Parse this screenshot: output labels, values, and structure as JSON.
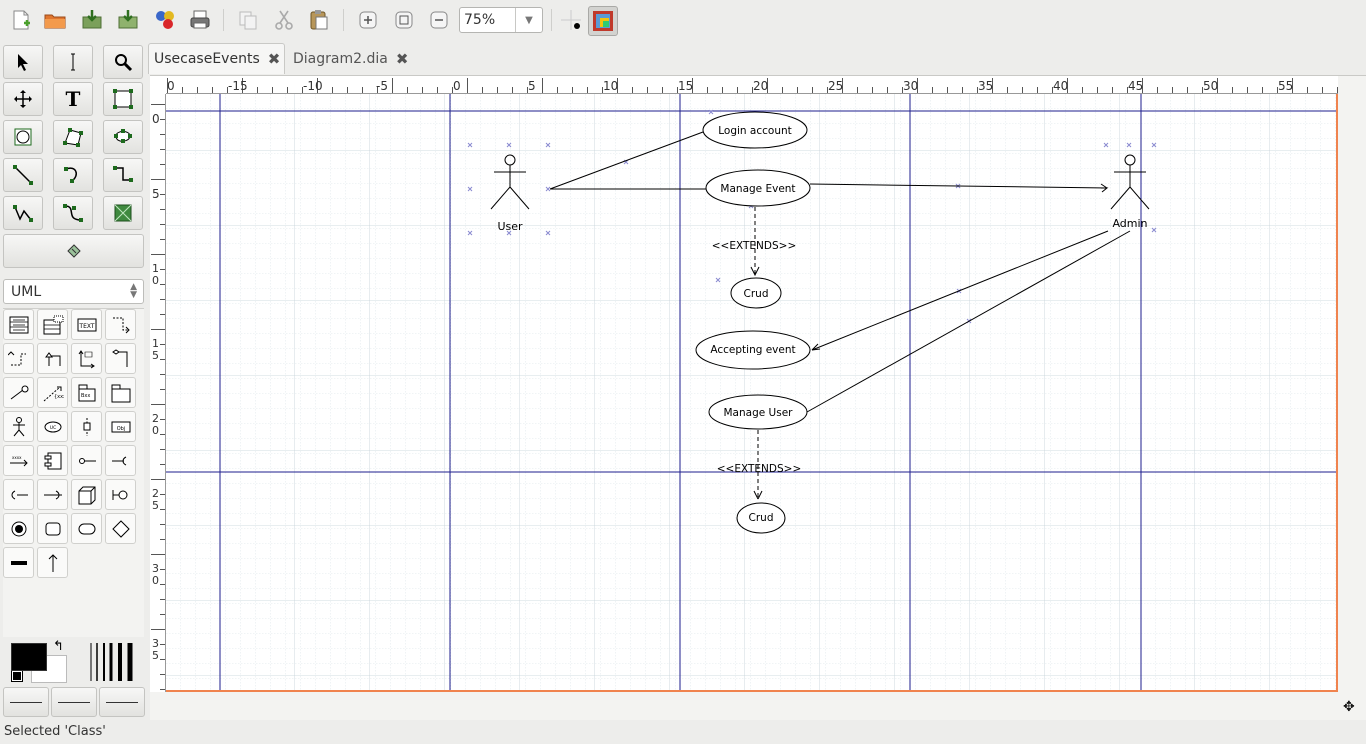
{
  "toolbar": {
    "buttons": [
      {
        "name": "new-diagram-icon"
      },
      {
        "name": "open-icon"
      },
      {
        "name": "save-icon"
      },
      {
        "name": "save-as-icon"
      },
      {
        "name": "export-icon"
      },
      {
        "name": "print-icon"
      },
      {
        "name": "copy-icon"
      },
      {
        "name": "cut-icon"
      },
      {
        "name": "paste-icon"
      },
      {
        "name": "zoom-in-icon"
      },
      {
        "name": "zoom-fit-icon"
      },
      {
        "name": "zoom-out-icon"
      },
      {
        "name": "snap-to-grid-icon"
      },
      {
        "name": "snap-to-objects-icon"
      }
    ],
    "zoom": "75%"
  },
  "toolbox": {
    "tools": [
      "pointer-tool",
      "text-edit-tool",
      "magnify-tool",
      "scroll-tool",
      "text-tool",
      "box-tool",
      "ellipse-tool",
      "polygon-tool",
      "beziergon-tool",
      "line-tool",
      "arc-tool",
      "zigzag-line-tool",
      "polyline-tool",
      "bezier-line-tool",
      "image-tool",
      "outline-tool"
    ],
    "sheet": "UML"
  },
  "tabs": [
    {
      "label": "UsecaseEvents",
      "active": true
    },
    {
      "label": "Diagram2.dia",
      "active": false
    }
  ],
  "ruler": {
    "h_labels": [
      "0",
      "-15",
      "-10",
      "-5",
      "0",
      "5",
      "10",
      "15",
      "20",
      "25",
      "30",
      "35",
      "40",
      "45",
      "50",
      "55"
    ],
    "v_labels": [
      "0",
      "5",
      "1\n0",
      "1\n5",
      "2\n0",
      "2\n5",
      "3\n0",
      "3\n5"
    ]
  },
  "diagram": {
    "actors": [
      "User",
      "Admin"
    ],
    "usecases": [
      "Login account",
      "Manage Event",
      "Crud",
      "Accepting event",
      "Manage User",
      "Crud"
    ],
    "stereotypes": [
      "<<EXTENDS>>",
      "<<EXTENDS>>"
    ]
  },
  "colors": {
    "accent_border": "#f0834e",
    "guide_line": "#1d1d8c",
    "foreground": "#000000",
    "background": "#ffffff"
  },
  "status": "Selected 'Class'"
}
